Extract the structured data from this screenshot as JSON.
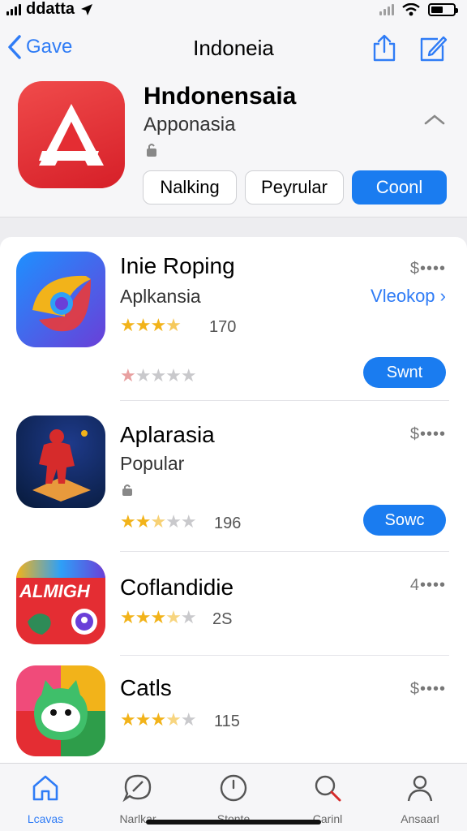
{
  "status": {
    "carrier": "ddatta"
  },
  "nav": {
    "back_label": "Gave",
    "title": "Indoneia"
  },
  "header": {
    "title": "Hndonensaia",
    "subtitle": "Apponasia",
    "buttons": [
      "Nalking",
      "Peyrular",
      "Coonl"
    ]
  },
  "apps": [
    {
      "title": "Inie Roping",
      "subtitle": "Aplkansia",
      "price": "$••••",
      "link": "Vleokop",
      "rating_count": "170",
      "action": "Swnt",
      "rating": 3.5,
      "second_rating": 1
    },
    {
      "title": "Aplarasia",
      "subtitle": "Popular",
      "price": "$••••",
      "rating_count": "196",
      "action": "Sowc",
      "rating": 2.5
    },
    {
      "title": "Coflandidie",
      "price": "4••••",
      "rating_count": "2S",
      "icon_text": "ALMIGH",
      "rating": 3.5
    },
    {
      "title": "Catls",
      "price": "$••••",
      "rating_count": "115",
      "rating": 3.5
    }
  ],
  "tabs": [
    {
      "label": "Lcavas",
      "icon": "home-icon"
    },
    {
      "label": "Narlkar",
      "icon": "chat-icon"
    },
    {
      "label": "Stonte",
      "icon": "clock-icon"
    },
    {
      "label": "Carinl",
      "icon": "search-icon"
    },
    {
      "label": "Ansaarl",
      "icon": "person-icon"
    }
  ],
  "colors": {
    "accent": "#1a7cf0",
    "star": "#f2b31a",
    "hero_icon": "#e42d33"
  }
}
